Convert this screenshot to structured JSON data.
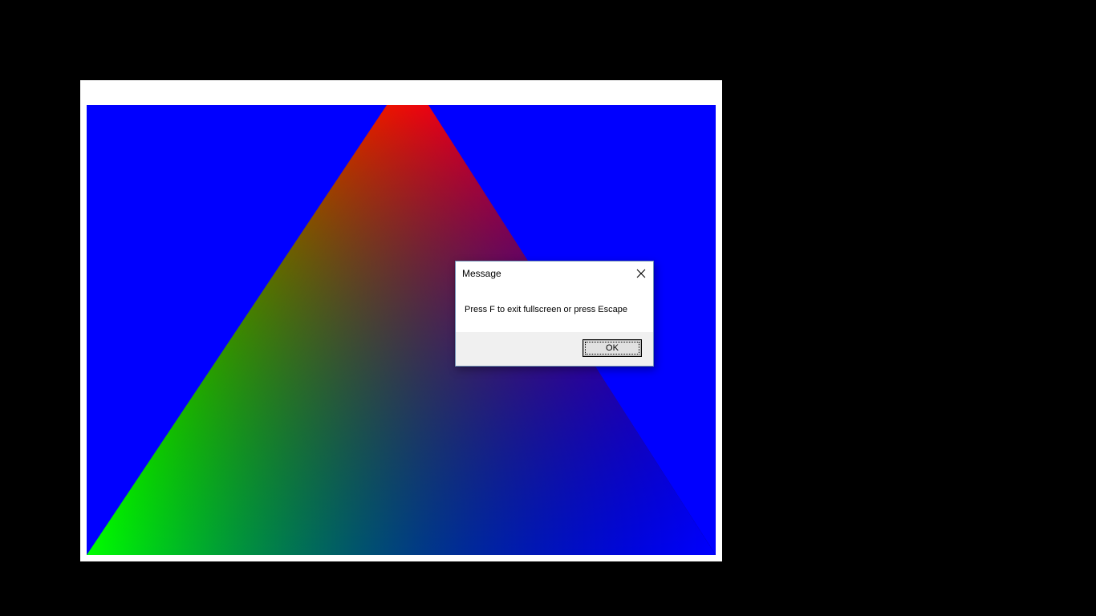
{
  "scene": {
    "background_color": "#000000",
    "window_background": "#ffffff",
    "clear_color": "#0000ff",
    "triangle": {
      "vertex_colors": {
        "top": "#ff0000",
        "bottom_left": "#00ff00",
        "bottom_right": "#0000ff"
      }
    }
  },
  "dialog": {
    "title": "Message",
    "message": "Press F to exit fullscreen or press Escape",
    "ok_label": "OK",
    "close_icon": "close-icon"
  }
}
